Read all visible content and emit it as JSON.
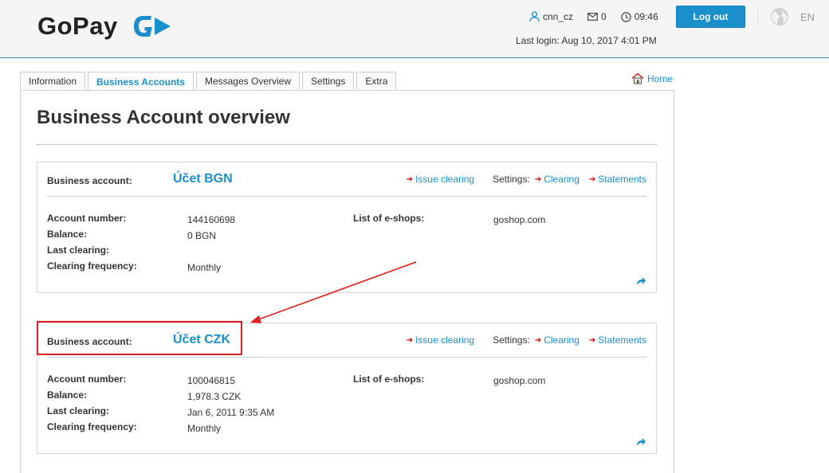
{
  "header": {
    "logo_text": "GoPay",
    "username": "cnn_cz",
    "messages_count": "0",
    "time": "09:46",
    "last_login": "Last login: Aug 10, 2017 4:01 PM",
    "logout_label": "Log out",
    "language": "EN"
  },
  "tabs": [
    {
      "label": "Information"
    },
    {
      "label": "Business Accounts",
      "active": true
    },
    {
      "label": "Messages Overview"
    },
    {
      "label": "Settings"
    },
    {
      "label": "Extra"
    }
  ],
  "home_label": "Home",
  "page_title": "Business Account overview",
  "accounts": [
    {
      "head_label": "Business account:",
      "name": "Účet BGN",
      "issue_clearing": "Issue clearing",
      "settings_label": "Settings:",
      "clearing_link": "Clearing",
      "statements_link": "Statements",
      "labels": {
        "account_number": "Account number:",
        "balance": "Balance:",
        "last_clearing": "Last clearing:",
        "clearing_frequency": "Clearing frequency:",
        "shops": "List of e-shops:"
      },
      "account_number": "144160698",
      "balance": "0 BGN",
      "last_clearing": "",
      "clearing_frequency": "Monthly",
      "shops": "goshop.com"
    },
    {
      "head_label": "Business account:",
      "name": "Účet CZK",
      "issue_clearing": "Issue clearing",
      "settings_label": "Settings:",
      "clearing_link": "Clearing",
      "statements_link": "Statements",
      "labels": {
        "account_number": "Account number:",
        "balance": "Balance:",
        "last_clearing": "Last clearing:",
        "clearing_frequency": "Clearing frequency:",
        "shops": "List of e-shops:"
      },
      "account_number": "100046815",
      "balance": "1,978.3 CZK",
      "last_clearing": "Jan 6, 2011 9:35 AM",
      "clearing_frequency": "Monthly",
      "shops": "goshop.com"
    }
  ],
  "colors": {
    "brand_blue": "#1a8fc9",
    "annotation_red": "#e02020"
  }
}
